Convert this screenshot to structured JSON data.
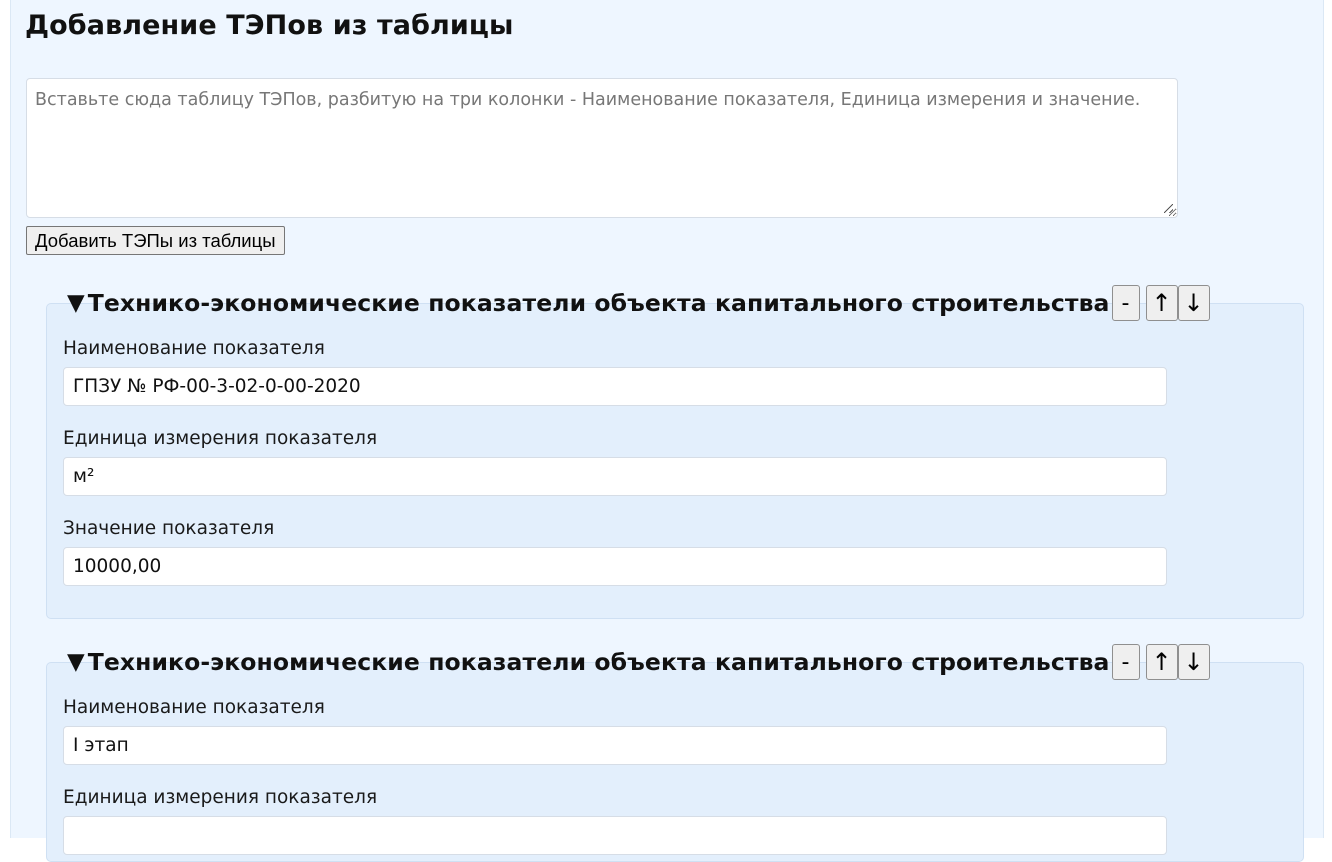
{
  "page": {
    "title": "Добавление ТЭПов из таблицы",
    "paste_placeholder": "Вставьте сюда таблицу ТЭПов, разбитую на три колонки - Наименование показателя, Единица измерения и значение.",
    "add_button": "Добавить ТЭПы из таблицы"
  },
  "groups": [
    {
      "toggle": "▼",
      "title": "Технико-экономические показатели объекта капитального строительства",
      "remove_label": "-",
      "up_label": "↑",
      "down_label": "↓",
      "fields": [
        {
          "label": "Наименование показателя",
          "value": "ГПЗУ № РФ-00-3-02-0-00-2020"
        },
        {
          "label": "Единица измерения показателя",
          "value": "м²"
        },
        {
          "label": "Значение показателя",
          "value": "10000,00"
        }
      ]
    },
    {
      "toggle": "▼",
      "title": "Технико-экономические показатели объекта капитального строительства",
      "remove_label": "-",
      "up_label": "↑",
      "down_label": "↓",
      "fields": [
        {
          "label": "Наименование показателя",
          "value": "I этап"
        },
        {
          "label": "Единица измерения показателя",
          "value": ""
        }
      ]
    }
  ]
}
